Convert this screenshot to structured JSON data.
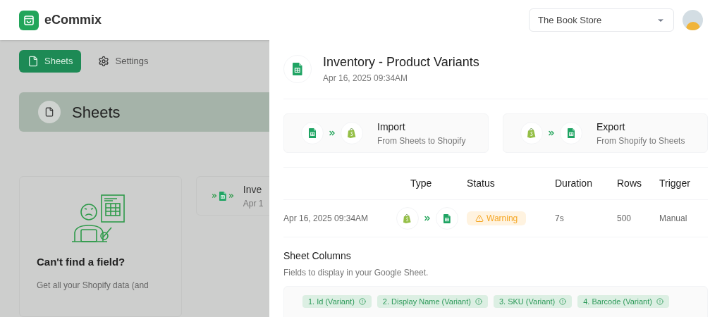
{
  "app": {
    "name": "eCommix"
  },
  "store_select": {
    "value": "The Book Store"
  },
  "nav_tabs": [
    {
      "label": "Sheets",
      "selected": true
    },
    {
      "label": "Settings",
      "selected": false
    }
  ],
  "banner": {
    "title": "Sheets"
  },
  "help_card": {
    "title": "Can't find a field?",
    "text": "Get all your Shopify data (and"
  },
  "sheet_card": {
    "title": "Inve",
    "date": "Apr 1"
  },
  "drawer": {
    "title": "Inventory - Product Variants",
    "date": "Apr 16, 2025 09:34AM",
    "directions": [
      {
        "kind": "import",
        "title": "Import",
        "subtitle": "From Sheets to Shopify"
      },
      {
        "kind": "export",
        "title": "Export",
        "subtitle": "From Shopify to Sheets"
      }
    ],
    "table": {
      "columns": [
        "Type",
        "Status",
        "Duration",
        "Rows",
        "Trigger"
      ],
      "rows": [
        {
          "date": "Apr 16, 2025 09:34AM",
          "kind": "export",
          "status": {
            "kind": "warning",
            "label": "Warning"
          },
          "duration": "7s",
          "rows": "500",
          "trigger": "Manual"
        }
      ]
    },
    "sheet_columns": {
      "title": "Sheet Columns",
      "subtitle": "Fields to display in your Google Sheet.",
      "chips": [
        "1. Id (Variant)",
        "2. Display Name (Variant)",
        "3. SKU (Variant)",
        "4. Barcode (Variant)"
      ]
    }
  }
}
